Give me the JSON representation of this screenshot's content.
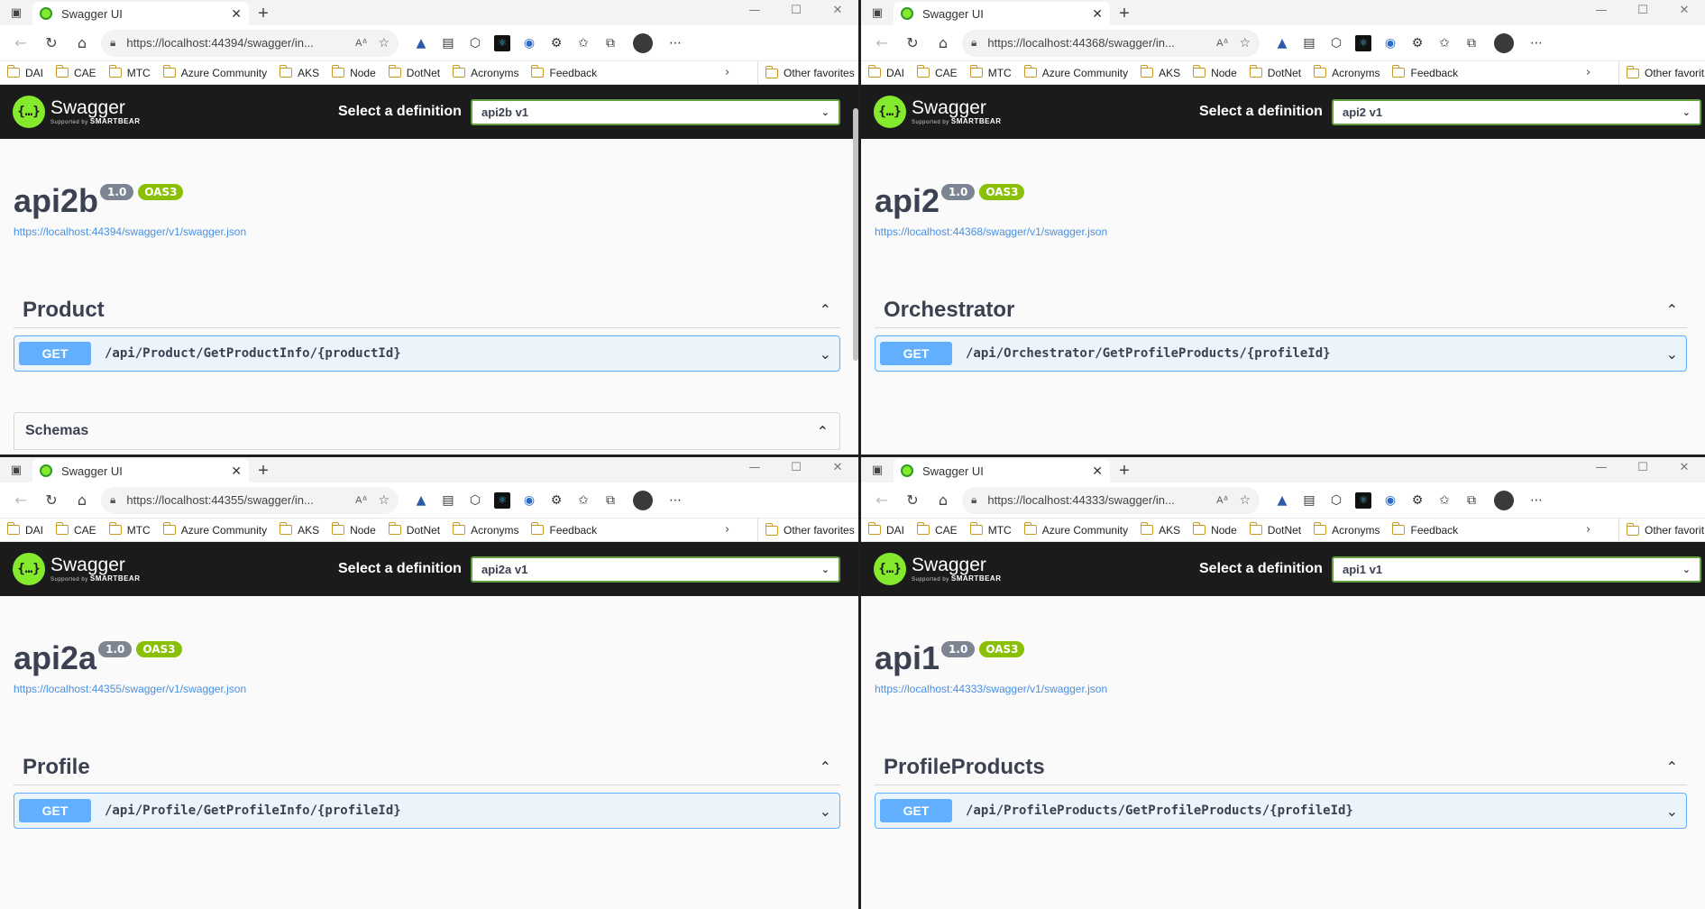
{
  "windows": [
    {
      "tab_title": "Swagger UI",
      "url": "https://localhost:44394/swagger/in...",
      "favorites": [
        "DAI",
        "CAE",
        "MTC",
        "Azure Community",
        "AKS",
        "Node",
        "DotNet",
        "Acronyms",
        "Feedback"
      ],
      "other_favorites": "Other favorites",
      "logo_name": "Swagger",
      "logo_sub_prefix": "Supported by",
      "logo_sub_brand": "SMARTBEAR",
      "select_label": "Select a definition",
      "select_value": "api2b v1",
      "api_title": "api2b",
      "version": "1.0",
      "oas": "OAS3",
      "json_url": "https://localhost:44394/swagger/v1/swagger.json",
      "tag": "Product",
      "method": "GET",
      "path": "/api/Product/GetProductInfo/{productId}",
      "schemas": "Schemas"
    },
    {
      "tab_title": "Swagger UI",
      "url": "https://localhost:44368/swagger/in...",
      "favorites": [
        "DAI",
        "CAE",
        "MTC",
        "Azure Community",
        "AKS",
        "Node",
        "DotNet",
        "Acronyms",
        "Feedback"
      ],
      "other_favorites": "Other favorit",
      "logo_name": "Swagger",
      "logo_sub_prefix": "Supported by",
      "logo_sub_brand": "SMARTBEAR",
      "select_label": "Select a definition",
      "select_value": "api2 v1",
      "api_title": "api2",
      "version": "1.0",
      "oas": "OAS3",
      "json_url": "https://localhost:44368/swagger/v1/swagger.json",
      "tag": "Orchestrator",
      "method": "GET",
      "path": "/api/Orchestrator/GetProfileProducts/{profileId}"
    },
    {
      "tab_title": "Swagger UI",
      "url": "https://localhost:44355/swagger/in...",
      "favorites": [
        "DAI",
        "CAE",
        "MTC",
        "Azure Community",
        "AKS",
        "Node",
        "DotNet",
        "Acronyms",
        "Feedback"
      ],
      "other_favorites": "Other favorites",
      "logo_name": "Swagger",
      "logo_sub_prefix": "Supported by",
      "logo_sub_brand": "SMARTBEAR",
      "select_label": "Select a definition",
      "select_value": "api2a v1",
      "api_title": "api2a",
      "version": "1.0",
      "oas": "OAS3",
      "json_url": "https://localhost:44355/swagger/v1/swagger.json",
      "tag": "Profile",
      "method": "GET",
      "path": "/api/Profile/GetProfileInfo/{profileId}"
    },
    {
      "tab_title": "Swagger UI",
      "url": "https://localhost:44333/swagger/in...",
      "favorites": [
        "DAI",
        "CAE",
        "MTC",
        "Azure Community",
        "AKS",
        "Node",
        "DotNet",
        "Acronyms",
        "Feedback"
      ],
      "other_favorites": "Other favorit",
      "logo_name": "Swagger",
      "logo_sub_prefix": "Supported by",
      "logo_sub_brand": "SMARTBEAR",
      "select_label": "Select a definition",
      "select_value": "api1 v1",
      "api_title": "api1",
      "version": "1.0",
      "oas": "OAS3",
      "json_url": "https://localhost:44333/swagger/v1/swagger.json",
      "tag": "ProfileProducts",
      "method": "GET",
      "path": "/api/ProfileProducts/GetProfileProducts/{profileId}"
    }
  ],
  "colors": {
    "swagger_green": "#85ea2d",
    "get_blue": "#61affe",
    "oas_green": "#89bf04",
    "topbar": "#1b1b1b"
  }
}
